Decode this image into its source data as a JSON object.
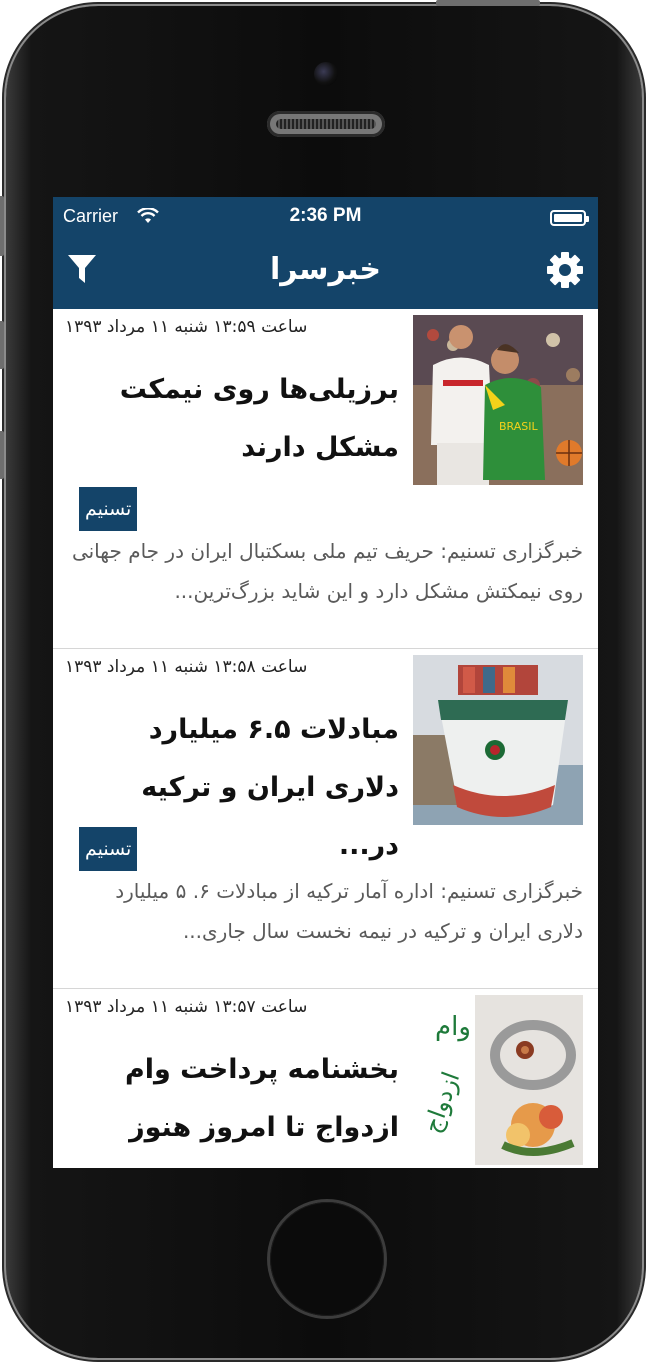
{
  "status_bar": {
    "carrier": "Carrier",
    "time": "2:36 PM"
  },
  "nav": {
    "title": "خبرسرا",
    "left_icon": "filter-icon",
    "right_icon": "gear-icon"
  },
  "colors": {
    "brand": "#144469",
    "summary_text": "#5a5a5a"
  },
  "news": [
    {
      "dateline": "ساعت ۱۳:۵۹ شنبه ۱۱ مرداد ۱۳۹۳",
      "headline": "برزیلی‌ها روی نیمکت مشکل دارند",
      "source": "تسنیم",
      "summary": "خبرگزاری تسنیم: حریف تیم ملی بسکتبال ایران در جام جهانی روی نیمکتش مشکل دارد و این شاید بزرگ‌ترین..."
    },
    {
      "dateline": "ساعت ۱۳:۵۸ شنبه ۱۱ مرداد ۱۳۹۳",
      "headline": "مبادلات ۶.۵ میلیارد دلاری ایران و ترکیه در...",
      "source": "تسنیم",
      "summary": "خبرگزاری تسنیم: اداره آمار ترکیه از مبادلات ۶. ۵ میلیارد دلاری ایران و ترکیه در نیمه نخست سال جاری..."
    },
    {
      "dateline": "ساعت ۱۳:۵۷ شنبه ۱۱ مرداد ۱۳۹۳",
      "headline": "بخشنامه پرداخت وام ازدواج تا امروز هنوز ابلا...",
      "source": "",
      "summary": "",
      "thumb_text": {
        "line1": "وام",
        "line2": "ازدواج"
      }
    }
  ]
}
